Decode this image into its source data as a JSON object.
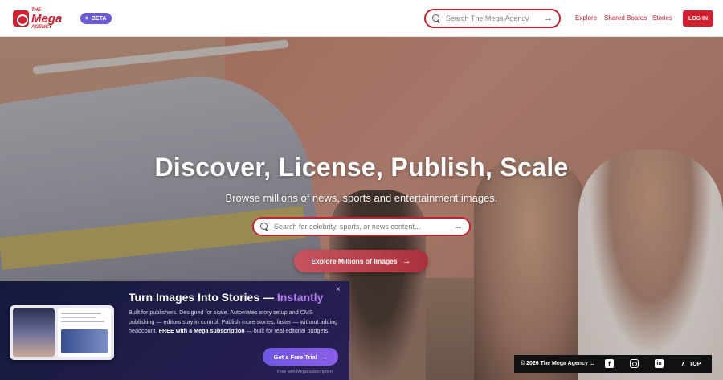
{
  "header": {
    "logo": {
      "the": "THE",
      "mega": "Mega",
      "agency": "AGENCY"
    },
    "beta_label": "BETA",
    "search": {
      "placeholder": "Search The Mega Agency"
    },
    "nav": {
      "explore": "Explore",
      "shared_boards": "Shared Boards",
      "stories": "Stories"
    },
    "login_label": "LOG IN"
  },
  "hero": {
    "title": "Discover, License, Publish, Scale",
    "subtitle": "Browse millions of news, sports and entertainment images.",
    "search": {
      "placeholder": "Search for celebrity, sports, or news content..."
    },
    "explore_label": "Explore Millions of Images"
  },
  "promo": {
    "heading": "Turn Images Into Stories — ",
    "heading_accent": "Instantly",
    "body_1": "Built for publishers. Designed for scale. Automates story setup and CMS publishing — editors stay in control. Publish more stories, faster — without adding headcount. ",
    "body_bold": "FREE with a Mega subscription",
    "body_2": " — built for real editorial budgets.",
    "trial_label": "Get a Free Trial",
    "trial_note": "Free with Mega subscription",
    "close": "×"
  },
  "footer": {
    "copyright": "© 2026 The Mega Agency ...",
    "top_label": "TOP"
  },
  "icons": {
    "search": "search-icon",
    "arrow": "→",
    "facebook": "f",
    "linkedin": "in",
    "chevron_up": "∧"
  },
  "colors": {
    "brand_red": "#d32030",
    "beta_purple": "#6b5bd6",
    "promo_accent": "#b57ff0",
    "promo_bg": "#1f1d4a"
  }
}
